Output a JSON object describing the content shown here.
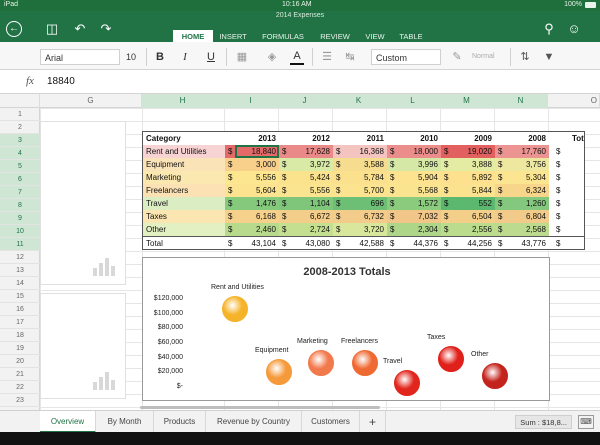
{
  "status": {
    "device": "iPad",
    "time": "10:16 AM",
    "battery": "100%"
  },
  "app": {
    "title": "2014 Expenses"
  },
  "ribbon": {
    "tabs": [
      "HOME",
      "INSERT",
      "FORMULAS",
      "REVIEW",
      "VIEW",
      "TABLE"
    ],
    "active_tab": "HOME"
  },
  "toolbar": {
    "font": "Arial",
    "size": "10",
    "bold": "B",
    "italic": "I",
    "underline": "U",
    "font_color_glyph": "A",
    "number_format": "Custom",
    "cell_style": "Normal"
  },
  "formula": {
    "fx": "fx",
    "value": "18840"
  },
  "columns": [
    "G",
    "H",
    "I",
    "J",
    "K",
    "L",
    "M",
    "N",
    "O"
  ],
  "rows": [
    "1",
    "2",
    "3",
    "4",
    "5",
    "6",
    "7",
    "8",
    "9",
    "10",
    "11",
    "12",
    "13",
    "14",
    "15",
    "16",
    "17",
    "18",
    "19",
    "20",
    "21",
    "22",
    "23"
  ],
  "table": {
    "header": [
      "Category",
      "2013",
      "2012",
      "2011",
      "2010",
      "2009",
      "2008",
      "Tot"
    ],
    "rows": [
      {
        "label": "Rent and Utilities",
        "values": [
          "18,840",
          "17,628",
          "16,368",
          "18,000",
          "19,020",
          "17,760"
        ]
      },
      {
        "label": "Equipment",
        "values": [
          "3,000",
          "3,972",
          "3,588",
          "3,996",
          "3,888",
          "3,756"
        ]
      },
      {
        "label": "Marketing",
        "values": [
          "5,556",
          "5,424",
          "5,784",
          "5,904",
          "5,892",
          "5,304"
        ]
      },
      {
        "label": "Freelancers",
        "values": [
          "5,604",
          "5,556",
          "5,700",
          "5,568",
          "5,844",
          "6,324"
        ]
      },
      {
        "label": "Travel",
        "values": [
          "1,476",
          "1,104",
          "696",
          "1,572",
          "552",
          "1,260"
        ]
      },
      {
        "label": "Taxes",
        "values": [
          "6,168",
          "6,672",
          "6,732",
          "7,032",
          "6,504",
          "6,804"
        ]
      },
      {
        "label": "Other",
        "values": [
          "2,460",
          "2,724",
          "3,720",
          "2,304",
          "2,556",
          "2,568"
        ]
      }
    ],
    "total": {
      "label": "Total",
      "values": [
        "43,104",
        "43,080",
        "42,588",
        "44,376",
        "44,256",
        "43,776"
      ]
    },
    "currency": "$"
  },
  "chart_data": {
    "type": "scatter",
    "title": "2008-2013 Totals",
    "ylim": [
      0,
      120000
    ],
    "yticks": [
      "$120,000",
      "$100,000",
      "$80,000",
      "$60,000",
      "$40,000",
      "$20,000",
      "$-"
    ],
    "points": [
      {
        "label": "Rent and Utilities",
        "value": 107616,
        "color": "#f5b32a"
      },
      {
        "label": "Equipment",
        "value": 22200,
        "color": "#f59a3a"
      },
      {
        "label": "Marketing",
        "value": 33864,
        "color": "#f2794b"
      },
      {
        "label": "Freelancers",
        "value": 34596,
        "color": "#ef6a33"
      },
      {
        "label": "Travel",
        "value": 6660,
        "color": "#e1261d"
      },
      {
        "label": "Taxes",
        "value": 39912,
        "color": "#e0201a"
      },
      {
        "label": "Other",
        "value": 16332,
        "color": "#c4231c"
      }
    ]
  },
  "sheets": [
    "Overview",
    "By Month",
    "Products",
    "Revenue by Country",
    "Customers"
  ],
  "active_sheet": "Overview",
  "add_sheet": "+",
  "sum_label": "Sum : $18,8..."
}
